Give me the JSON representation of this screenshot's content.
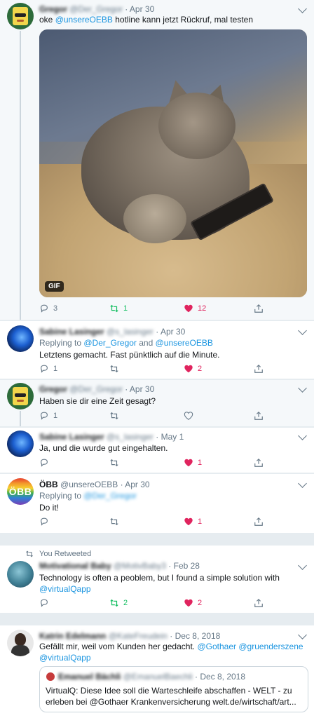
{
  "colors": {
    "link": "#1b95e0",
    "retweet_green": "#17bf63",
    "like_red": "#e0245e",
    "muted": "#657786",
    "background": "#e6ecf0"
  },
  "tweets": [
    {
      "name": "Gregor",
      "handle": "@Der_Gregor",
      "date": "Apr 30",
      "text_prefix": "oke ",
      "mention": "@unsereOEBB",
      "text_suffix": " hotline kann jetzt Rückruf, mal testen",
      "media_badge": "GIF",
      "reply_count": "3",
      "retweet_count": "1",
      "like_count": "12"
    },
    {
      "name": "Sabine Lasinger",
      "handle": "@s_lasinger",
      "date": "Apr 30",
      "replying_label": "Replying to ",
      "replying_a": "@Der_Gregor",
      "replying_and": " and ",
      "replying_b": "@unsereOEBB",
      "text": "Letztens gemacht. Fast pünktlich auf die Minute.",
      "reply_count": "1",
      "retweet_count": "",
      "like_count": "2"
    },
    {
      "name": "Gregor",
      "handle": "@Der_Gregor",
      "date": "Apr 30",
      "text": "Haben sie dir eine Zeit gesagt?",
      "reply_count": "1",
      "retweet_count": "",
      "like_count": ""
    },
    {
      "name": "Sabine Lasinger",
      "handle": "@s_lasinger",
      "date": "May 1",
      "text": "Ja, und die wurde gut eingehalten.",
      "reply_count": "",
      "retweet_count": "",
      "like_count": "1"
    },
    {
      "name": "ÖBB",
      "handle": "@unsereOEBB",
      "date": "Apr 30",
      "avatar_text": "ÖBB",
      "replying_label": "Replying to ",
      "replying_a": "@Der_Gregor",
      "text": "Do it!",
      "reply_count": "",
      "retweet_count": "",
      "like_count": "1"
    },
    {
      "retweet_label": "You Retweeted",
      "name": "Motivational Baby",
      "handle": "@MotivBaby3",
      "date": "Feb 28",
      "text_prefix": "Technology is often a peoblem, but I found a simple solution with ",
      "mention": "@virtualQapp",
      "reply_count": "",
      "retweet_count": "2",
      "like_count": "2"
    },
    {
      "name": "Katrin Edelmann",
      "handle": "@KateFreudein",
      "date": "Dec 8, 2018",
      "text_prefix": "Gefällt mir, weil vom Kunden her gedacht. ",
      "mention_a": "@Gothaer",
      "mention_b": "@gruenderszene",
      "mention_c": "@virtualQapp",
      "quote": {
        "name": "Emanuel Bächli",
        "handle": "@EmanuelBaechli",
        "date": "Dec 8, 2018",
        "text": "VirtualQ: Diese Idee soll die Warteschleife abschaffen - WELT - zu erleben bei @Gothaer Krankenversicherung  welt.de/wirtschaft/art..."
      }
    }
  ]
}
